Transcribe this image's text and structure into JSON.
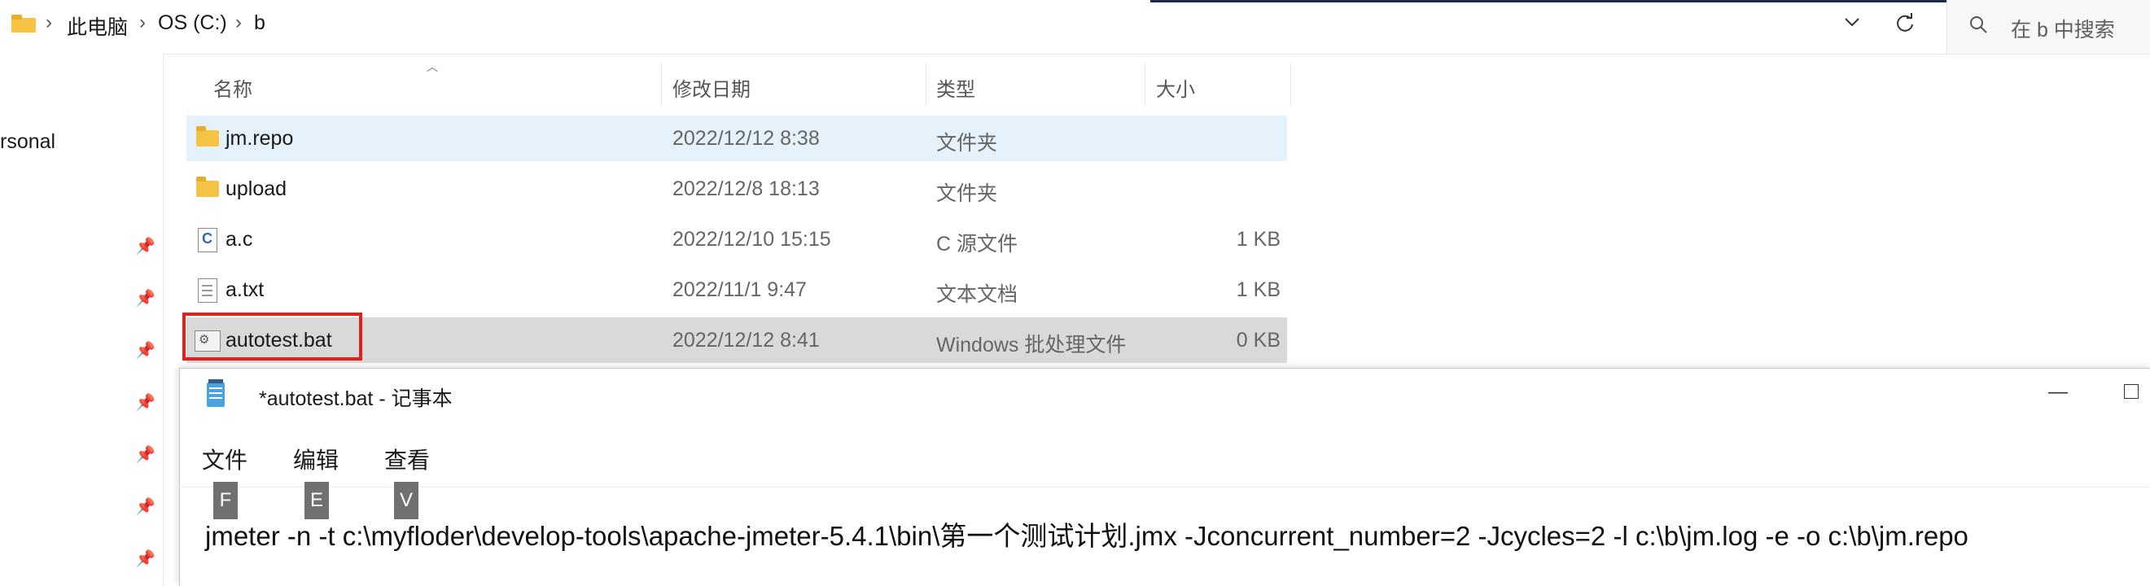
{
  "explorer": {
    "breadcrumb": [
      "此电脑",
      "OS (C:)",
      "b"
    ],
    "search_placeholder": "在 b 中搜索",
    "sidebar_partial_label": "rsonal",
    "columns": {
      "name": "名称",
      "date": "修改日期",
      "type": "类型",
      "size": "大小"
    },
    "files": [
      {
        "name": "jm.repo",
        "date": "2022/12/12 8:38",
        "type": "文件夹",
        "size": "",
        "icon": "folder-icon"
      },
      {
        "name": "upload",
        "date": "2022/12/8 18:13",
        "type": "文件夹",
        "size": "",
        "icon": "folder-icon"
      },
      {
        "name": "a.c",
        "date": "2022/12/10 15:15",
        "type": "C 源文件",
        "size": "1 KB",
        "icon": "c-file-icon"
      },
      {
        "name": "a.txt",
        "date": "2022/11/1 9:47",
        "type": "文本文档",
        "size": "1 KB",
        "icon": "text-file-icon"
      },
      {
        "name": "autotest.bat",
        "date": "2022/12/12 8:41",
        "type": "Windows 批处理文件",
        "size": "0 KB",
        "icon": "batch-file-icon"
      }
    ]
  },
  "notepad": {
    "title": "*autotest.bat - 记事本",
    "menu": [
      {
        "label": "文件",
        "key": "F"
      },
      {
        "label": "编辑",
        "key": "E"
      },
      {
        "label": "查看",
        "key": "V"
      }
    ],
    "content": "jmeter -n -t c:\\myfloder\\develop-tools\\apache-jmeter-5.4.1\\bin\\第一个测试计划.jmx -Jconcurrent_number=2 -Jcycles=2 -l c:\\b\\jm.log -e -o c:\\b\\jm.repo"
  },
  "colors": {
    "selected_row": "#e5f1fb",
    "hover_row": "#d9d9d9",
    "highlight_box": "#e0201b",
    "title_bar_line": "#1e2a4a"
  }
}
